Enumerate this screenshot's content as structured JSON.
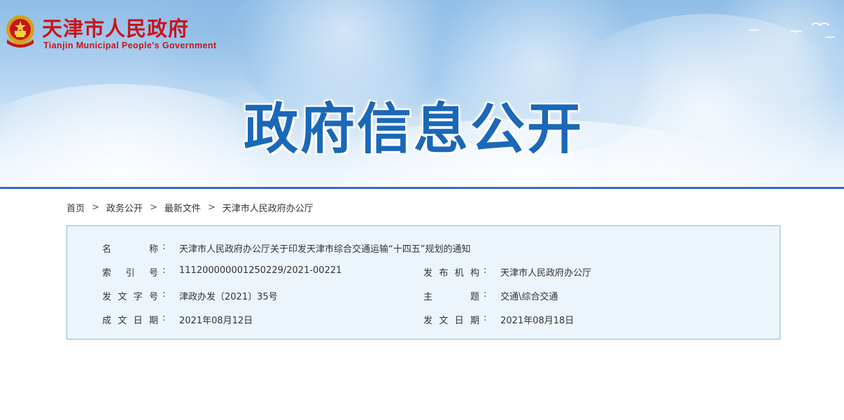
{
  "header": {
    "site_name": "天津市人民政府",
    "site_name_en": "Tianjin Municipal People's Government",
    "banner_title": "政府信息公开"
  },
  "breadcrumb": [
    {
      "label": "首页"
    },
    {
      "label": "政务公开"
    },
    {
      "label": "最新文件"
    },
    {
      "label": "天津市人民政府办公厅"
    }
  ],
  "breadcrumb_sep": ">",
  "info": {
    "colon": ":",
    "name_label_chars": [
      "名",
      "称"
    ],
    "name_value": "天津市人民政府办公厅关于印发天津市综合交通运输“十四五”规划的通知",
    "index_label_chars": [
      "索",
      "引",
      "号"
    ],
    "index_value": "111200000001250229/2021-00221",
    "issuer_label_chars": [
      "发",
      "布",
      "机",
      "构"
    ],
    "issuer_value": "天津市人民政府办公厅",
    "doc_no_label_chars": [
      "发",
      "文",
      "字",
      "号"
    ],
    "doc_no_value": "津政办发〔2021〕35号",
    "subject_label_chars": [
      "主",
      "题"
    ],
    "subject_value": "交通\\综合交通",
    "created_label_chars": [
      "成",
      "文",
      "日",
      "期"
    ],
    "created_value": "2021年08月12日",
    "published_label_chars": [
      "发",
      "文",
      "日",
      "期"
    ],
    "published_value": "2021年08月18日"
  },
  "colors": {
    "brand_red": "#c8141a",
    "title_blue": "#1a68b8",
    "box_bg": "#edf5fc",
    "box_border": "#8cb5dc"
  }
}
